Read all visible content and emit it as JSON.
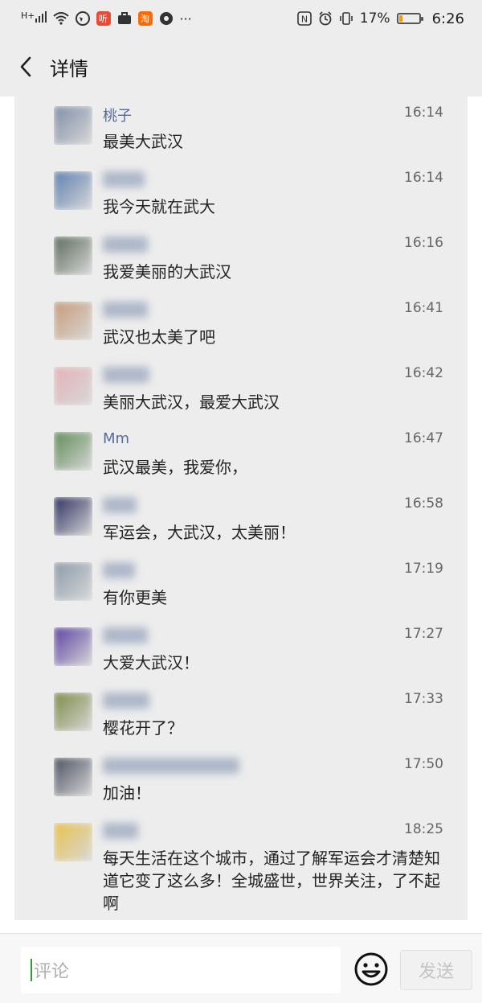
{
  "status_bar": {
    "signal_label": "H+",
    "battery_percent": "17%",
    "battery_level": 0.17,
    "time": "6:26",
    "app_icons": [
      "ting-app-icon",
      "briefcase-icon",
      "taobao-icon",
      "wechat-moments-icon"
    ],
    "more": "···",
    "nfc_label": "N"
  },
  "header": {
    "title": "详情"
  },
  "comments": [
    {
      "name": "桃子",
      "time": "16:14",
      "text": "最美大武汉",
      "name_blurred": false,
      "avatar_color": "#7d8ea6"
    },
    {
      "name": "",
      "time": "16:14",
      "text": "我今天就在武大",
      "name_blurred": true,
      "avatar_color": "#5d7fb0"
    },
    {
      "name": "",
      "time": "16:16",
      "text": "我爱美丽的大武汉",
      "name_blurred": true,
      "avatar_color": "#5b6a5a"
    },
    {
      "name": "",
      "time": "16:41",
      "text": "武汉也太美了吧",
      "name_blurred": true,
      "avatar_color": "#c79a78"
    },
    {
      "name": "",
      "time": "16:42",
      "text": "美丽大武汉，最爱大武汉",
      "name_blurred": true,
      "avatar_color": "#e3b1b6"
    },
    {
      "name": "Mm",
      "time": "16:47",
      "text": "武汉最美，我爱你，",
      "name_blurred": false,
      "avatar_color": "#5e8a55"
    },
    {
      "name": "",
      "time": "16:58",
      "text": "军运会，大武汉，太美丽！",
      "name_blurred": true,
      "avatar_color": "#2a2e5e"
    },
    {
      "name": "",
      "time": "17:19",
      "text": "有你更美",
      "name_blurred": true,
      "avatar_color": "#8a9aa8"
    },
    {
      "name": "",
      "time": "17:27",
      "text": "大爱大武汉！",
      "name_blurred": true,
      "avatar_color": "#5a3fa0"
    },
    {
      "name": "",
      "time": "17:33",
      "text": "樱花开了？",
      "name_blurred": true,
      "avatar_color": "#7b8a45"
    },
    {
      "name": "",
      "time": "17:50",
      "text": "加油！",
      "name_blurred": true,
      "avatar_color": "#4a5060"
    },
    {
      "name": "",
      "time": "18:25",
      "text": "每天生活在这个城市，通过了解军运会才清楚知道它变了这么多！全城盛世，世界关注，了不起啊",
      "name_blurred": true,
      "avatar_color": "#e8c24a"
    }
  ],
  "footer": {
    "input_placeholder": "评论",
    "send_label": "发送"
  }
}
